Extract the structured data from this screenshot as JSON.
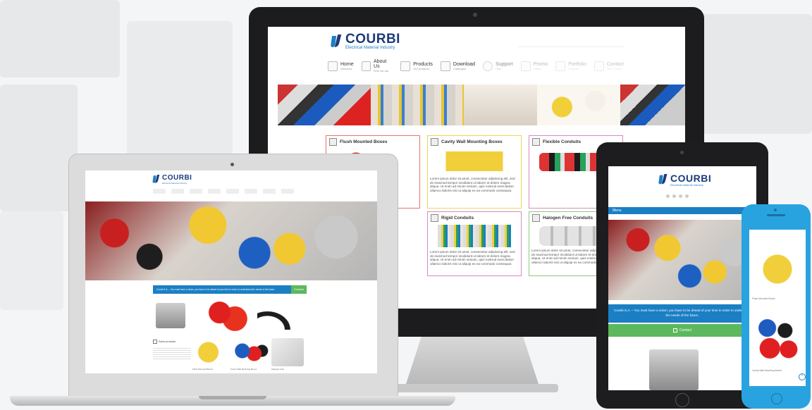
{
  "brand": {
    "name": "COURBI",
    "tagline": "Electrical Material Industry"
  },
  "desktop": {
    "nav": [
      {
        "label": "Home",
        "sub": "Welcome"
      },
      {
        "label": "About Us",
        "sub": "Who we are"
      },
      {
        "label": "Products",
        "sub": "Our products"
      },
      {
        "label": "Download",
        "sub": "Catalogue"
      },
      {
        "label": "Support",
        "sub": "Help"
      },
      {
        "label": "Promo",
        "sub": "Offers"
      },
      {
        "label": "Portfolio",
        "sub": "Projects"
      },
      {
        "label": "Contact",
        "sub": "Get in touch"
      }
    ],
    "cards": [
      {
        "title": "Flush Mounted Boxes",
        "border": "#e8746b"
      },
      {
        "title": "Cavity Wall Mounting Boxes",
        "border": "#e9d65a"
      },
      {
        "title": "Flexible Conduits",
        "border": "#d889c6"
      },
      {
        "title": "Rigid Conduits",
        "border": "#d889c6"
      },
      {
        "title": "Halogen Free Conduits",
        "border": "#8fc77e"
      }
    ],
    "lorem": "Lorem ipsum dolor sit amet, consectetur adipiscing elit, sed do eiusmod tempor incididunt ut labore et dolore magna aliqua. Ut enim ad minim veniam, quis nostrud exercitation ullamco laboris nisi ut aliquip ex ea commodo consequat."
  },
  "laptop": {
    "banner_text": "Courbi S.A. – You must have a vision, you have to be ahead of your time in order to understand the needs of the future.",
    "contact_label": "Contact",
    "some_products_label": "Some products",
    "product_captions": [
      "Flush Mounted Boxes",
      "Cavity Wall Mounting Boxes",
      "Halogen Free"
    ]
  },
  "tablet": {
    "menu_label": "Menu",
    "banner_text": "Courbi S.A. – You must have a vision, you have to be ahead of your time in order to understand the needs of the future.",
    "contact_label": "Contact"
  },
  "phone": {
    "caption_top": "Flush Mounted Boxes",
    "caption_bottom": "Cavity Wall Mounting Boxes"
  },
  "colors": {
    "brand_blue": "#1b7fc4",
    "brand_navy": "#1d3a7a",
    "contact_green": "#5cb85c",
    "phone_blue": "#29a3e0"
  }
}
